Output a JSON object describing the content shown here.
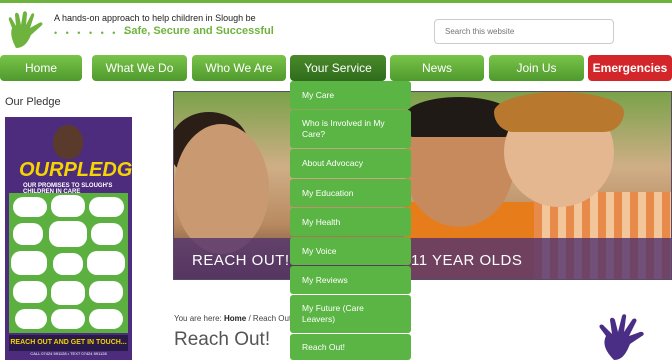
{
  "header": {
    "tagline": "A hands-on approach to help children in Slough be",
    "dots": "• • • • • • •",
    "safe_line": "Safe, Secure and Successful",
    "search_placeholder": "Search this website"
  },
  "nav": [
    {
      "label": "Home"
    },
    {
      "label": "What We Do"
    },
    {
      "label": "Who We Are"
    },
    {
      "label": "Your Service"
    },
    {
      "label": "News"
    },
    {
      "label": "Join Us"
    },
    {
      "label": "Emergencies"
    }
  ],
  "dropdown": [
    {
      "label": "My Care"
    },
    {
      "label": "Who is Involved in My Care?"
    },
    {
      "label": "About Advocacy"
    },
    {
      "label": "My Education"
    },
    {
      "label": "My Health"
    },
    {
      "label": "My Voice"
    },
    {
      "label": "My Reviews"
    },
    {
      "label": "My Future (Care Leavers)"
    },
    {
      "label": "Reach Out!"
    }
  ],
  "sidebar": {
    "title": "Our Pledge",
    "poster_title": "OURPLEDGE",
    "poster_sub": "OUR PROMISES TO SLOUGH'S CHILDREN IN CARE",
    "poster_foot": "REACH OUT AND GET IN TOUCH...",
    "poster_contact": "CALL 07424 591128 • TEXT 07424 591128"
  },
  "banner": {
    "text_left": "REACH OUT!",
    "text_right": "11 YEAR OLDS"
  },
  "breadcrumb": {
    "prefix": "You are here:",
    "home": "Home",
    "sep": "/",
    "current": "Reach Out"
  },
  "page": {
    "heading": "Reach Out!"
  },
  "colors": {
    "brand_green": "#6fb33f",
    "nav_red": "#d3262a",
    "overlay_purple": "#54346e"
  }
}
